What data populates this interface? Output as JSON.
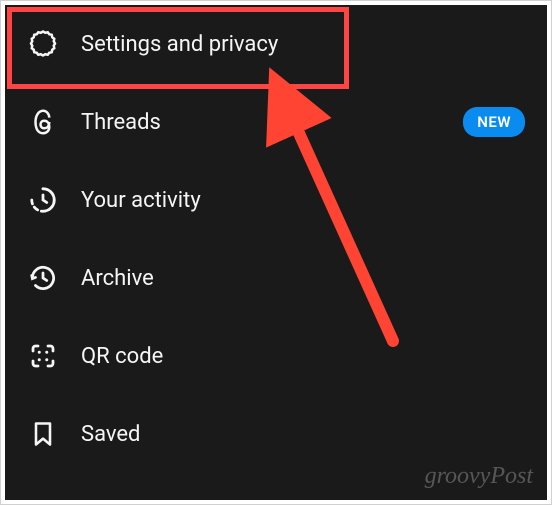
{
  "menu": {
    "items": [
      {
        "label": "Settings and privacy",
        "icon": "gear-icon",
        "badge": null
      },
      {
        "label": "Threads",
        "icon": "at-icon",
        "badge": "NEW"
      },
      {
        "label": "Your activity",
        "icon": "clock-dashed-icon",
        "badge": null
      },
      {
        "label": "Archive",
        "icon": "history-icon",
        "badge": null
      },
      {
        "label": "QR code",
        "icon": "qr-icon",
        "badge": null
      },
      {
        "label": "Saved",
        "icon": "bookmark-icon",
        "badge": null
      }
    ]
  },
  "watermark": "groovyPost",
  "annotation": {
    "highlight_target": "menu.items.0",
    "arrow_color": "#ff4433"
  }
}
